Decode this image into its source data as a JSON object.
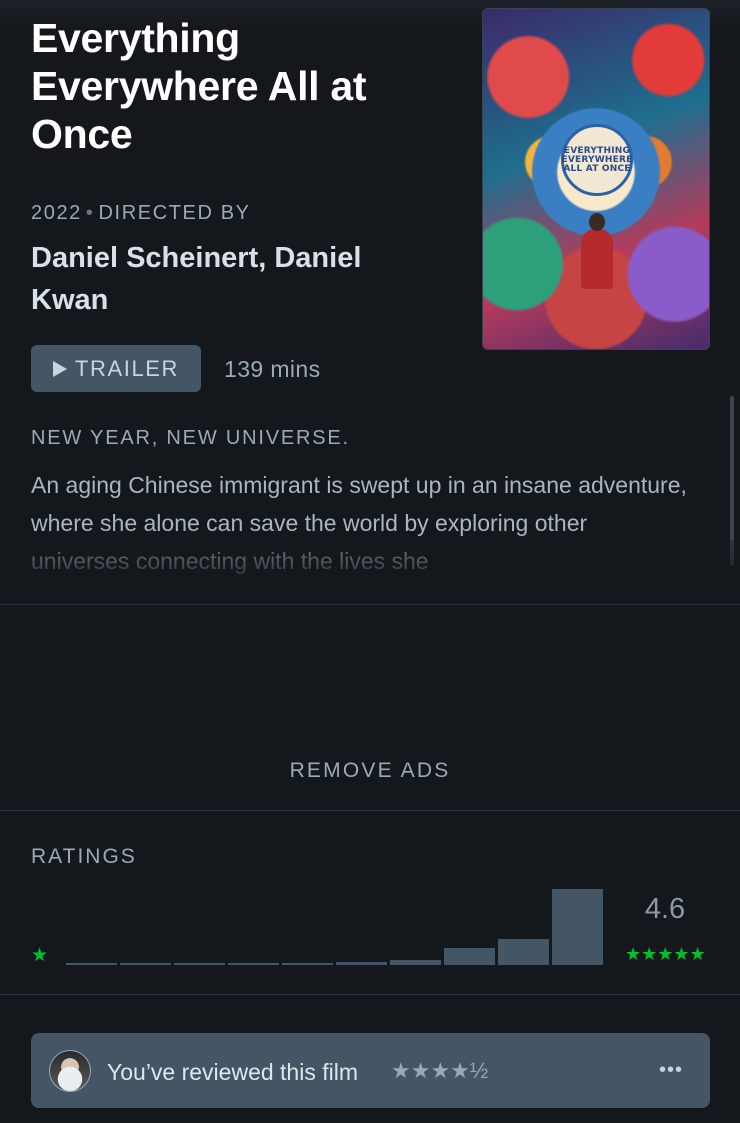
{
  "film": {
    "title": "Everything Everywhere All at Once",
    "year": "2022",
    "directed_by_label": "DIRECTED BY",
    "directors": "Daniel Scheinert, Daniel Kwan",
    "poster_text": [
      "EVERYTHING",
      "EVERYWHERE",
      "ALL AT ONCE"
    ]
  },
  "actions": {
    "trailer_label": "TRAILER",
    "runtime": "139 mins"
  },
  "tagline": "NEW YEAR, NEW UNIVERSE.",
  "synopsis": "An aging Chinese immigrant is swept up in an insane adventure, where she alone can save the world by exploring other universes connecting with the lives she",
  "ads": {
    "remove_label": "REMOVE ADS"
  },
  "ratings": {
    "label": "RATINGS",
    "average": "4.6",
    "min_stars": "★",
    "max_stars": "★★★★★",
    "histogram_fraction": [
      0.02,
      0.02,
      0.02,
      0.02,
      0.02,
      0.04,
      0.07,
      0.22,
      0.34,
      1.0
    ]
  },
  "review": {
    "text": "You’ve reviewed this film",
    "stars": "★★★★½",
    "more": "•••"
  },
  "colors": {
    "background": "#14181c",
    "accent_green": "#00c030",
    "card": "#445566",
    "muted_text": "#99aabb"
  },
  "icons": [
    "play-icon",
    "more-icon",
    "star-icon",
    "avatar"
  ]
}
